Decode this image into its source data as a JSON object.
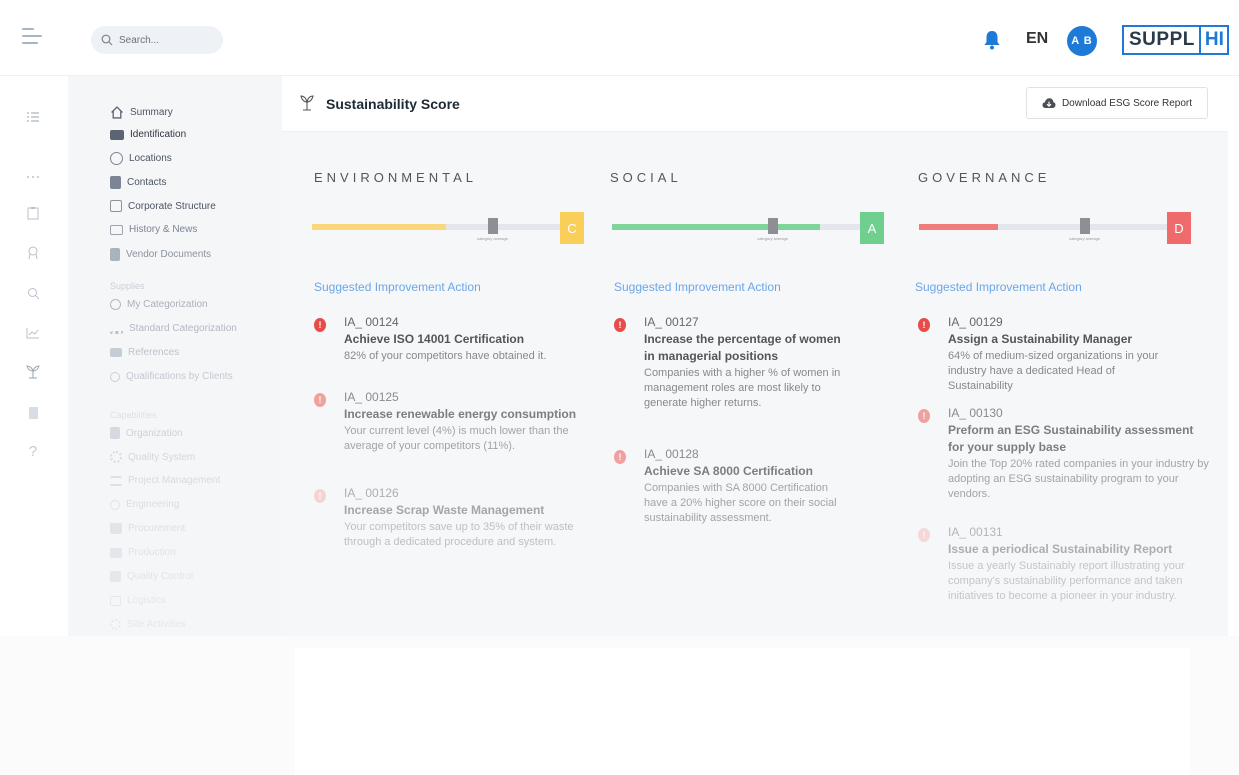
{
  "header": {
    "search_placeholder": "Search...",
    "language": "EN",
    "avatar_initials": "A B",
    "logo_part1": "SUPPL",
    "logo_part2": "HI"
  },
  "rail_icons": [
    "checklist-icon",
    "dots-icon",
    "clipboard-icon",
    "award-icon",
    "search-icon",
    "chart-icon",
    "leaf-icon",
    "document-icon",
    "help-icon"
  ],
  "sidebar": {
    "items": [
      {
        "label": "Summary",
        "icon": "home-icon"
      },
      {
        "label": "Identification",
        "icon": "id-card-icon"
      },
      {
        "label": "Locations",
        "icon": "globe-icon"
      },
      {
        "label": "Contacts",
        "icon": "contacts-icon"
      },
      {
        "label": "Corporate Structure",
        "icon": "building-icon"
      },
      {
        "label": "History & News",
        "icon": "news-icon"
      },
      {
        "label": "Vendor Documents",
        "icon": "document-icon"
      }
    ],
    "section_supplies": "Supplies",
    "supplies_items": [
      {
        "label": "My Categorization"
      },
      {
        "label": "Standard Categorization"
      },
      {
        "label": "References"
      },
      {
        "label": "Qualifications by Clients"
      }
    ],
    "section_capabilities": "Capabilities",
    "capabilities_items": [
      {
        "label": "Organization"
      },
      {
        "label": "Quality System"
      },
      {
        "label": "Project Management"
      },
      {
        "label": "Engineering"
      },
      {
        "label": "Procurement"
      },
      {
        "label": "Production"
      },
      {
        "label": "Quality Control"
      },
      {
        "label": "Logistics"
      },
      {
        "label": "Site Activities"
      }
    ]
  },
  "main": {
    "title": "Sustainability Score",
    "download_label": "Download ESG Score Report",
    "suggested_label": "Suggested Improvement Action",
    "avg_label": "category average",
    "columns": [
      {
        "heading": "ENVIRONMENTAL",
        "grade": "C",
        "grade_color": "#f9cf5a",
        "fill_color": "#f9d77a",
        "score_fraction": 0.54,
        "avg_fraction": 0.73,
        "actions": [
          {
            "code": "IA_ 00124",
            "title": "Achieve ISO 14001 Certification",
            "desc": "82% of your competitors have obtained it.",
            "alert_color": "#e94a4a"
          },
          {
            "code": "IA_ 00125",
            "title": "Increase renewable energy consumption",
            "desc": "Your current level (4%) is much lower than the average of your competitors (11%).",
            "alert_color": "#f08383"
          },
          {
            "code": "IA_ 00126",
            "title": "Increase Scrap Waste Management",
            "desc": "Your competitors save up to 35% of their waste through a dedicated procedure and system.",
            "alert_color": "#f6b1b1"
          }
        ]
      },
      {
        "heading": "SOCIAL",
        "grade": "A",
        "grade_color": "#6fcf8f",
        "fill_color": "#7fd49a",
        "score_fraction": 0.84,
        "avg_fraction": 0.65,
        "actions": [
          {
            "code": "IA_ 00127",
            "title": "Increase the percentage of women in managerial positions",
            "desc": "Companies with a higher % of women in management roles are most likely to generate higher returns.",
            "alert_color": "#e94a4a"
          },
          {
            "code": "IA_ 00128",
            "title": "Achieve SA 8000 Certification",
            "desc": "Companies with SA 8000 Certification have a 20% higher score on their social sustainability assessment.",
            "alert_color": "#f08383"
          }
        ]
      },
      {
        "heading": "GOVERNANCE",
        "grade": "D",
        "grade_color": "#ef6b6b",
        "fill_color": "#f07c7c",
        "score_fraction": 0.32,
        "avg_fraction": 0.67,
        "actions": [
          {
            "code": "IA_ 00129",
            "title": "Assign a Sustainability Manager",
            "desc": "64% of medium-sized organizations in your industry have a dedicated Head of Sustainability",
            "alert_color": "#e94a4a"
          },
          {
            "code": "IA_ 00130",
            "title": "Preform an ESG Sustainability assessment for your supply base",
            "desc": "Join the Top 20% rated companies in your industry by adopting an ESG sustainability program to your vendors.",
            "alert_color": "#f08383"
          },
          {
            "code": "IA_ 00131",
            "title": "Issue a periodical Sustainability Report",
            "desc": "Issue a yearly Sustainably report illustrating your company's sustainability performance and taken initiatives to become a pioneer in your industry.",
            "alert_color": "#f6b1b1"
          }
        ]
      }
    ]
  }
}
